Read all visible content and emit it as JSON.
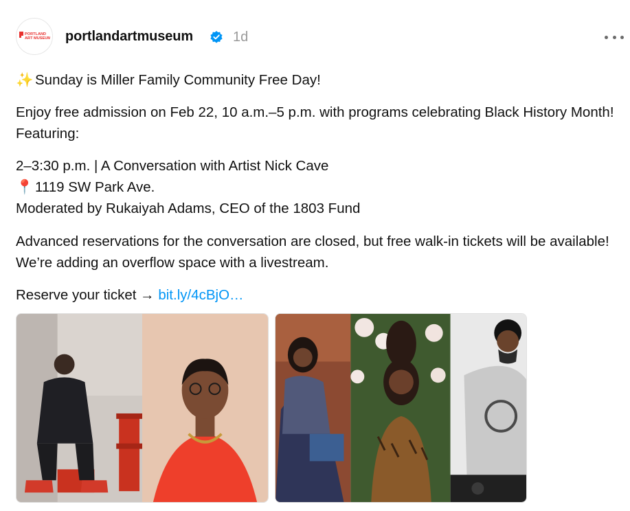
{
  "post": {
    "username": "portlandartmuseum",
    "time": "1d",
    "avatar_logo_lines": [
      "PORTLAND",
      "ART MUSEUM"
    ],
    "verified_icon": "verified-badge-icon",
    "more_icon": "more-horizontal-icon",
    "line1_emoji": "✨",
    "line1": "Sunday is Miller Family Community Free Day!",
    "line2": "Enjoy free admission on Feb 22, 10 a.m.–5 p.m. with programs celebrating Black History Month! Featuring:",
    "line3": "2–3:30 p.m. | A Conversation with Artist Nick Cave",
    "line4_emoji": "📍",
    "line4": "1119 SW Park Ave.",
    "line5": "Moderated by Rukaiyah Adams, CEO of the 1803 Fund",
    "line6": "Advanced reservations for the conversation are closed, but free walk-in tickets will be available! We’re adding an overflow space with a livestream.",
    "line7_prefix": "Reserve your ticket → ",
    "line7_link": "bit.ly/4cBjO…"
  },
  "colors": {
    "brand_red": "#e8312f",
    "verified_blue": "#0095f6",
    "link_blue": "#0095f6",
    "meta_gray": "#999999"
  }
}
